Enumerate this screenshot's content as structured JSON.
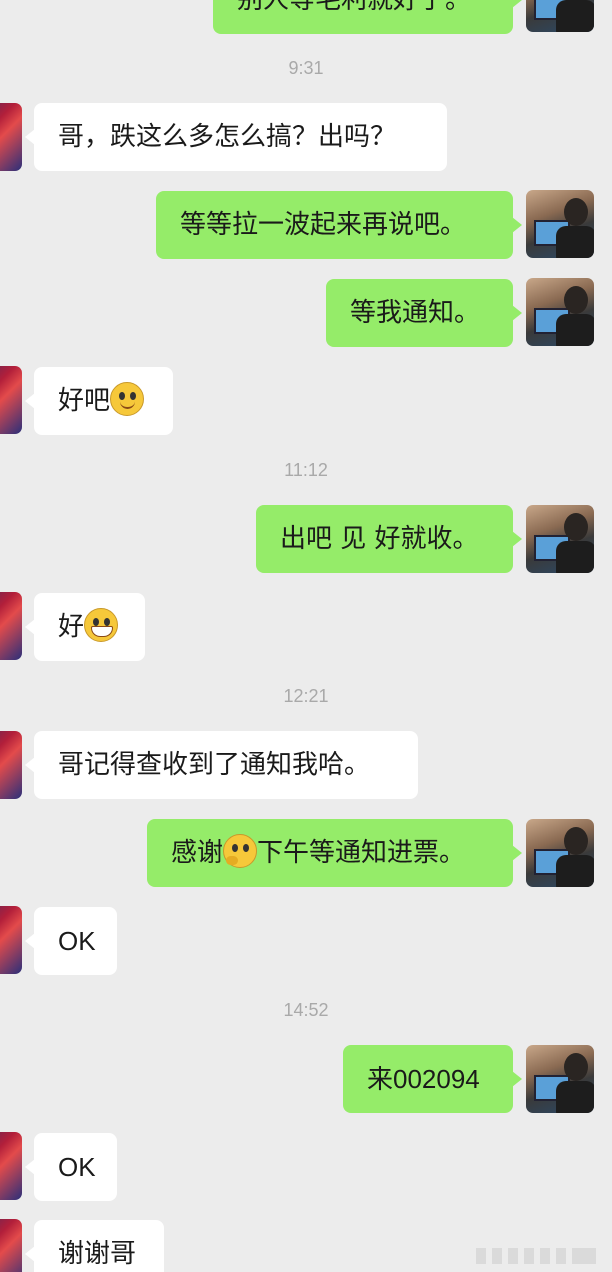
{
  "conversation": {
    "messages": [
      {
        "kind": "out",
        "text": "别人等毛利就好了。",
        "cut": true
      },
      {
        "kind": "time",
        "text": "9:31"
      },
      {
        "kind": "in",
        "text": "哥，跌这么多怎么搞？出吗？"
      },
      {
        "kind": "out",
        "text": "等等拉一波起来再说吧。"
      },
      {
        "kind": "out",
        "text": "等我通知。"
      },
      {
        "kind": "in",
        "text": "好吧",
        "emoji": "smile-emoji"
      },
      {
        "kind": "time",
        "text": "11:12"
      },
      {
        "kind": "out",
        "text": "出吧 见 好就收。"
      },
      {
        "kind": "in",
        "text": "好",
        "emoji": "grin-emoji"
      },
      {
        "kind": "time",
        "text": "12:21"
      },
      {
        "kind": "in",
        "text": "哥记得查收到了通知我哈。"
      },
      {
        "kind": "out",
        "text_before": "感谢",
        "emoji": "thinking-emoji",
        "text_after": "下午等通知进票。"
      },
      {
        "kind": "in",
        "text": "OK"
      },
      {
        "kind": "time",
        "text": "14:52"
      },
      {
        "kind": "out",
        "text": "来002094"
      },
      {
        "kind": "in",
        "text": "OK"
      },
      {
        "kind": "in",
        "text": "谢谢哥",
        "cut": true
      }
    ]
  },
  "colors": {
    "background": "#ececec",
    "outgoing_bubble": "#95ec69",
    "incoming_bubble": "#ffffff",
    "timestamp": "#a9a9a9"
  },
  "icons": {
    "incoming_avatar": "red-blue-abstract-avatar-icon",
    "outgoing_avatar": "man-at-computer-avatar-icon"
  }
}
